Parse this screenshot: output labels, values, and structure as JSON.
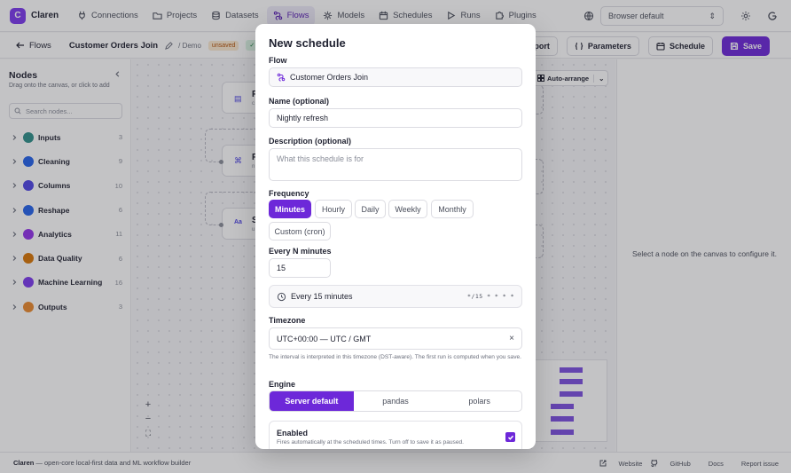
{
  "app": {
    "name": "Claren",
    "logo_letter": "C",
    "accent": "#6d28d9"
  },
  "nav": {
    "items": [
      {
        "label": "Connections",
        "icon": "plug-icon"
      },
      {
        "label": "Projects",
        "icon": "folder-icon"
      },
      {
        "label": "Datasets",
        "icon": "database-icon"
      },
      {
        "label": "Flows",
        "icon": "flow-icon",
        "active": true
      },
      {
        "label": "Models",
        "icon": "models-icon"
      },
      {
        "label": "Schedules",
        "icon": "calendar-icon"
      },
      {
        "label": "Runs",
        "icon": "play-icon"
      },
      {
        "label": "Plugins",
        "icon": "puzzle-icon"
      }
    ],
    "browser_select": "Browser default"
  },
  "toolbar": {
    "back_label": "Flows",
    "flow_title": "Customer Orders Join",
    "project": "/ Demo",
    "unsaved_badge": "unsaved",
    "valid_badge": "va",
    "export_label": "Export",
    "parameters_label": "Parameters",
    "schedule_label": "Schedule",
    "save_label": "Save"
  },
  "sidebar": {
    "title": "Nodes",
    "hint": "Drag onto the canvas, or click to add",
    "search_placeholder": "Search nodes...",
    "categories": [
      {
        "label": "Inputs",
        "count": "3",
        "color": "#2f8f8a"
      },
      {
        "label": "Cleaning",
        "count": "9",
        "color": "#2563eb"
      },
      {
        "label": "Columns",
        "count": "10",
        "color": "#4f46e5"
      },
      {
        "label": "Reshape",
        "count": "6",
        "color": "#2563eb"
      },
      {
        "label": "Analytics",
        "count": "11",
        "color": "#9333ea"
      },
      {
        "label": "Data Quality",
        "count": "6",
        "color": "#d97706"
      },
      {
        "label": "Machine Learning",
        "count": "16",
        "color": "#7c3aed"
      },
      {
        "label": "Outputs",
        "count": "3",
        "color": "#ea8a2e"
      }
    ]
  },
  "canvas": {
    "auto_arrange_label": "Auto-arrange",
    "node_letters": [
      "F",
      "F",
      "S"
    ],
    "node_sub": [
      "c",
      "n",
      "u"
    ]
  },
  "right_panel": {
    "empty_message": "Select a node on the canvas to configure it."
  },
  "footer": {
    "brand": "Claren",
    "tagline": " — open-core local-first data and ML workflow builder",
    "links": [
      "Website",
      "GitHub",
      "Docs",
      "Report issue"
    ]
  },
  "modal": {
    "title": "New schedule",
    "flow_label": "Flow",
    "flow_value": "Customer Orders Join",
    "name_label": "Name (optional)",
    "name_value": "Nightly refresh",
    "description_label": "Description (optional)",
    "description_placeholder": "What this schedule is for",
    "frequency_label": "Frequency",
    "frequency_options": [
      "Minutes",
      "Hourly",
      "Daily",
      "Weekly",
      "Monthly",
      "Custom (cron)"
    ],
    "frequency_selected": "Minutes",
    "every_label": "Every N minutes",
    "every_value": "15",
    "summary": "Every 15 minutes",
    "cron_expression": "*/15 * * * *",
    "timezone_label": "Timezone",
    "timezone_value": "UTC+00:00 — UTC / GMT",
    "timezone_help": "The interval is interpreted in this timezone (DST-aware). The first run is computed when you save.",
    "engine_label": "Engine",
    "engine_options": [
      "Server default",
      "pandas",
      "polars"
    ],
    "engine_selected": "Server default",
    "enabled_label": "Enabled",
    "enabled_help": "Fires automatically at the scheduled times. Turn off to save it as paused.",
    "enabled": true
  }
}
